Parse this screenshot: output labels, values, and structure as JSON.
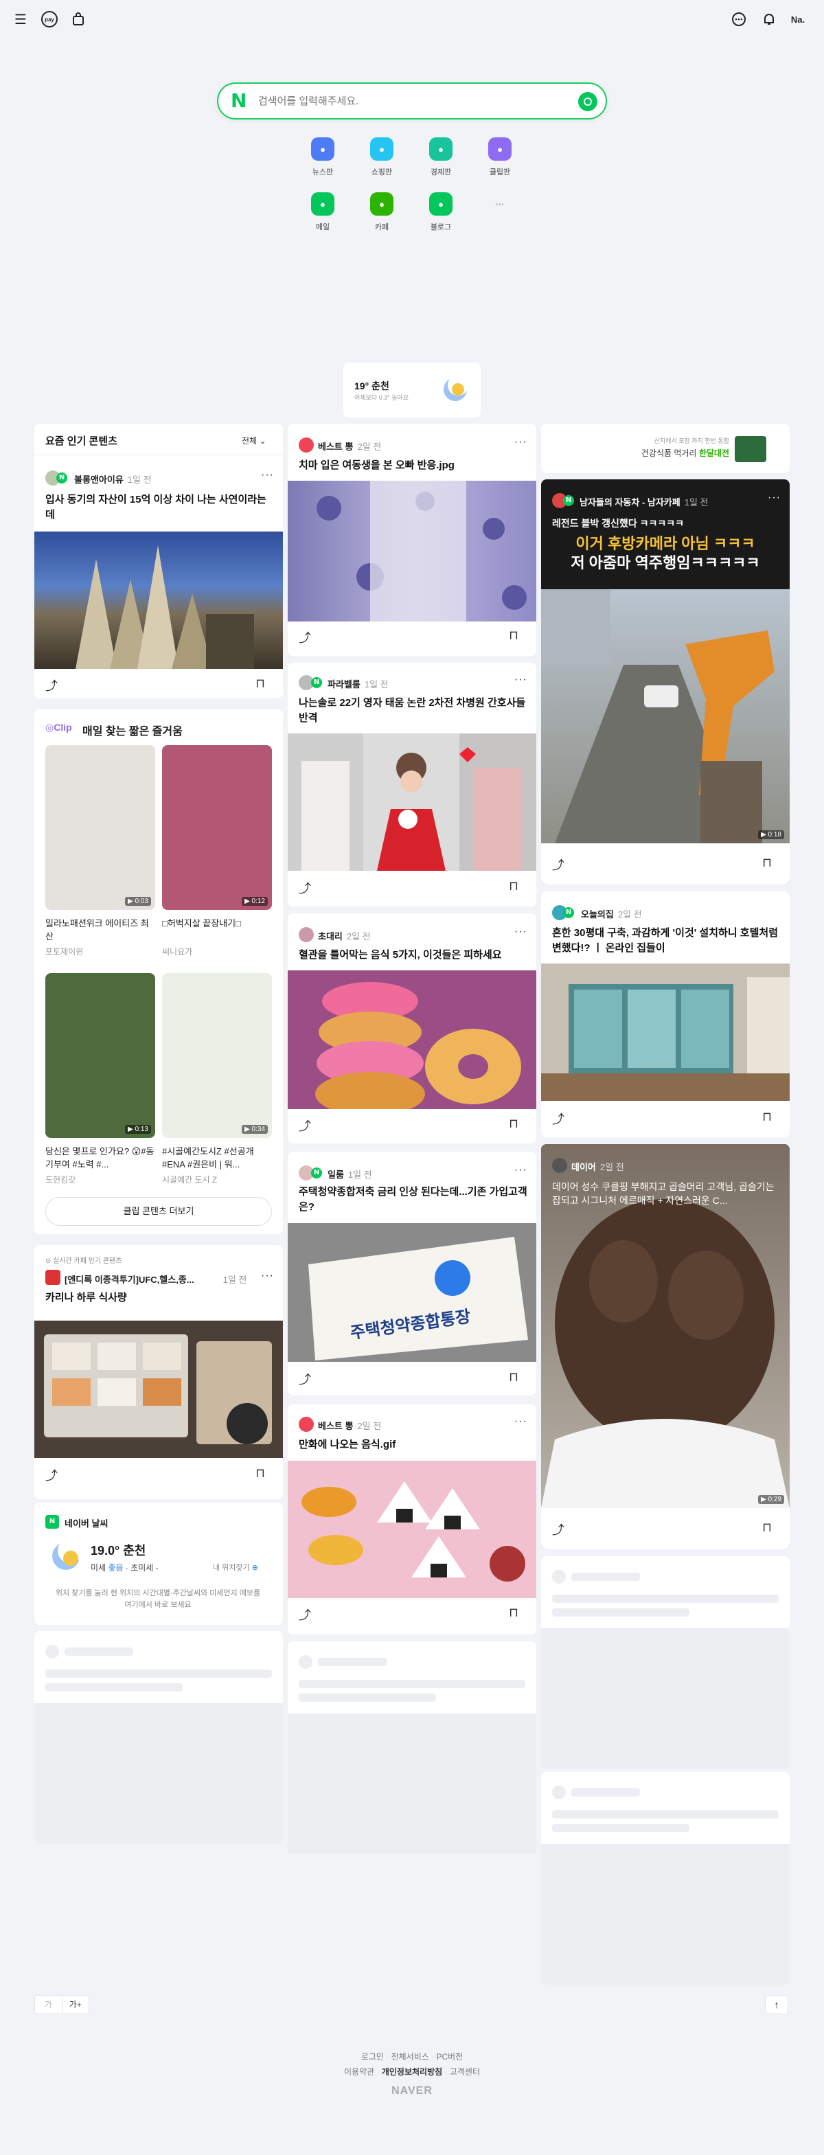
{
  "header": {
    "menu_icon": "hamburger-menu-icon",
    "pay_label": "pay",
    "profile_label": "Na."
  },
  "search": {
    "placeholder": "검색어를 입력해주세요."
  },
  "shortcuts": [
    {
      "label": "뉴스판",
      "icon": "news-icon",
      "color": "#4e7cf6"
    },
    {
      "label": "쇼핑판",
      "icon": "shopping-icon",
      "color": "#26c4f0"
    },
    {
      "label": "경제판",
      "icon": "economy-icon",
      "color": "#19c39b"
    },
    {
      "label": "클립판",
      "icon": "clip-icon",
      "color": "#8f6af2"
    },
    {
      "label": "메일",
      "icon": "mail-icon",
      "color": "#03c75a"
    },
    {
      "label": "카페",
      "icon": "cafe-icon",
      "color": "#2db400"
    },
    {
      "label": "블로그",
      "icon": "blog-icon",
      "color": "#03c75a"
    }
  ],
  "weather_mini": {
    "temp": "19° 춘천",
    "desc": "어제보다 0.3° 높아요"
  },
  "col1": {
    "header_title": "요즘 인기 콘텐츠",
    "header_filter": "전체",
    "post1": {
      "author": "볼롱앤아이유",
      "time": "1일 전",
      "title": "입사 동기의 자산이 15억 이상 차이 나는 사연이라는데"
    },
    "clip": {
      "title": "매일 찾는 짧은 즐거움",
      "items": [
        {
          "caption": "밀라노패션위크 에이티즈 최산",
          "sub": "포토제이윈",
          "dur": "0:03"
        },
        {
          "caption": "□허벅지살 끝장내기□",
          "sub": "써니요가",
          "dur": "0:12"
        },
        {
          "caption": "당신은 몇프로 인가요? 😮#동기부여 #노력 #...",
          "sub": "도현킹갓",
          "dur": "0:13"
        },
        {
          "caption": "#시골예간도시Z #선공개 #ENA #권은비 | 워...",
          "sub": "시골예간 도시 Z",
          "dur": "0:34"
        }
      ],
      "more_button": "클립 콘텐츠 더보기"
    },
    "cafe_post": {
      "kicker": "실시간 카페 인기 콘텐츠",
      "author": "[엔디록 이종격투기]UFC,헬스,종...",
      "time": "1일 전",
      "title": "카리나 하루 식사량"
    },
    "weather": {
      "title": "네이버 날씨",
      "temp": "19.0° 춘천",
      "dust_label": "미세",
      "dust_value": "좋음",
      "ultra": "초미세 -",
      "locate": "내 위치찾기",
      "desc": "위치 찾기를 눌러 현 위치의 시간대별·주간날씨와 미세먼지 예보를 여기에서 바로 보세요"
    }
  },
  "col2": {
    "post1": {
      "author": "베스트 뽕",
      "time": "2일 전",
      "title": "치마 입은 여동생을 본 오빠 반응.jpg"
    },
    "post2": {
      "author": "파라벨룸",
      "time": "1일 전",
      "title": "나는솔로 22기 영자 태움 논란 2차전 차병원 간호사들 반격"
    },
    "post3": {
      "author": "초대리",
      "time": "2일 전",
      "title": "혈관을 틀어막는 음식 5가지, 이것들은 피하세요"
    },
    "post4": {
      "author": "일룸",
      "time": "1일 전",
      "title": "주택청약종합저축 금리 인상 된다는데...기존 가입고객은?",
      "image_text": "주택청약종합통장"
    },
    "post5": {
      "author": "베스트 뽕",
      "time": "2일 전",
      "title": "만화에 나오는 음식.gif"
    }
  },
  "col3": {
    "ad": {
      "text1": "산지에서 포장 까지 한번 통합",
      "text2": "건강식품 먹거리",
      "text3": "한달대전"
    },
    "post1": {
      "author": "남자들의 자동차 - 남자카페",
      "time": "1일 전",
      "overlay1": "레전드 블박 갱신했다 ㅋㅋㅋㅋㅋ",
      "overlay2": "이거 후방카메라 아님 ㅋㅋㅋ",
      "overlay3": "저 아줌마 역주행임ㅋㅋㅋㅋㅋ",
      "dur": "0:18"
    },
    "post2": {
      "author": "오늘의집",
      "time": "2일 전",
      "title": "흔한 30평대 구축, 과감하게 '이것' 설치하니 호텔처럼 변했다!? ㅣ 온라인 집들이"
    },
    "post3": {
      "author": "데이어",
      "time": "2일 전",
      "title": "데이어 성수 쿠클핑 부해지고 곱슬머리 고객님, 곱슬기는 잡되고 시그니처 에르매직 + 자연스러운 C...",
      "dur": "0:29"
    }
  },
  "bottom": {
    "font_minus": "가",
    "font_plus": "가+"
  },
  "footer": {
    "links_row1": [
      "로그인",
      "전체서비스",
      "PC버전"
    ],
    "links_row2": [
      "이용약관",
      "개인정보처리방침",
      "고객센터"
    ],
    "brand": "NAVER"
  }
}
